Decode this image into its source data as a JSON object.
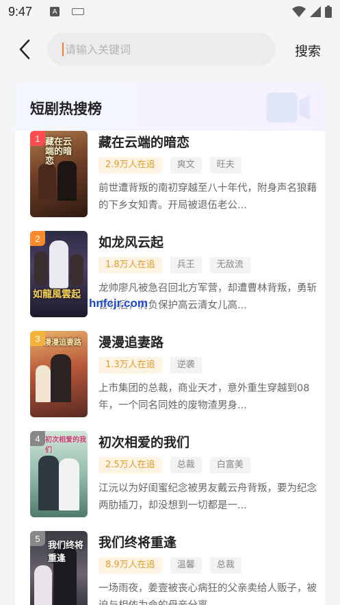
{
  "status": {
    "time": "9:47"
  },
  "search": {
    "placeholder": "请输入关键词",
    "button_label": "搜索"
  },
  "section": {
    "title": "短剧热搜榜"
  },
  "items": [
    {
      "rank": "1",
      "title": "藏在云端的暗恋",
      "followers": "2.9万人在追",
      "tags": [
        "爽文",
        "旺夫"
      ],
      "desc": "前世遭背叛的南初穿越至八十年代，附身声名狼藉的下乡女知青。开局被退伍老公...",
      "rank_color": "#ff4d4f",
      "cover_text": "藏在云端的暗恋"
    },
    {
      "rank": "2",
      "title": "如龙风云起",
      "followers": "1.8万人在追",
      "tags": [
        "兵王",
        "无敌流"
      ],
      "desc": "龙帅廖凡被急召回北方军营，却遭曹林背叛，勇斩曹林后，肩负保护高云清女儿高...",
      "rank_color": "#ff8a2b",
      "cover_text": "如龍風雲起"
    },
    {
      "rank": "3",
      "title": "漫漫追妻路",
      "followers": "1.3万人在追",
      "tags": [
        "逆袭"
      ],
      "desc": "上市集团的总裁，商业天才，意外重生穿越到08年，一个同名同姓的废物渣男身...",
      "rank_color": "#f5b23b",
      "cover_text": "漫漫追妻路"
    },
    {
      "rank": "4",
      "title": "初次相爱的我们",
      "followers": "2.5万人在追",
      "tags": [
        "总裁",
        "白富美"
      ],
      "desc": "江沅以为好闺蜜纪念被男友戴云舟背叛，要为纪念两肋插刀，却没想到一切都是一...",
      "rank_color": "#888888",
      "cover_text": "初次相爱的我们"
    },
    {
      "rank": "5",
      "title": "我们终将重逢",
      "followers": "8.9万人在追",
      "tags": [
        "温馨",
        "总裁"
      ],
      "desc": "一场雨夜，姜壹被丧心病狂的父亲卖给人贩子，被迫与相依为命的母亲分离...",
      "rank_color": "#888888",
      "cover_text": "我们终将重逢"
    }
  ],
  "watermark": "hnfcjr.com",
  "colors": {
    "accent": "#ff7a2e",
    "hot_tag_bg": "#fff4e3",
    "hot_tag_text": "#e59a2c"
  }
}
